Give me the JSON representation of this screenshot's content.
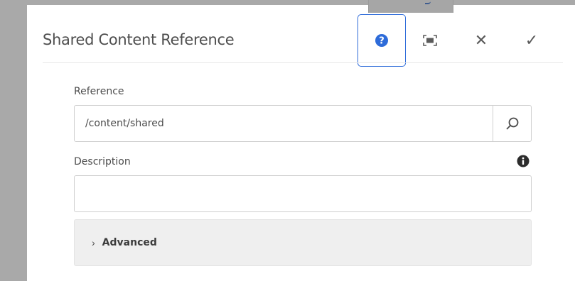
{
  "dialog": {
    "title": "Shared Content Reference",
    "toolbar": {
      "help_icon": "help-circle-icon",
      "fullscreen_icon": "fullscreen-icon",
      "close_glyph": "✕",
      "done_glyph": "✓"
    }
  },
  "form": {
    "reference": {
      "label": "Reference",
      "value": "/content/shared",
      "icon": "search-icon"
    },
    "description": {
      "label": "Description",
      "value": "",
      "info_icon": "info-icon"
    },
    "advanced": {
      "chevron": "›",
      "label": "Advanced"
    }
  },
  "colors": {
    "accent": "#2d6bd9",
    "backdrop": "#a9a9a9",
    "advanced_bg": "#efefef"
  }
}
